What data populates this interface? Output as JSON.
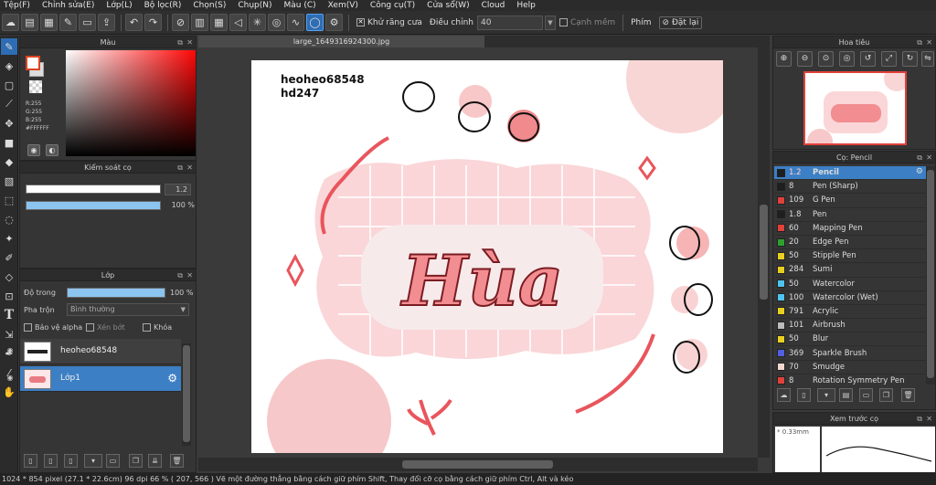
{
  "menu": [
    "Tệp(F)",
    "Chỉnh sửa(E)",
    "Lớp(L)",
    "Bộ lọc(R)",
    "Chọn(S)",
    "Chụp(N)",
    "Màu (C)",
    "Xem(V)",
    "Công cụ(T)",
    "Cửa sổ(W)",
    "Cloud",
    "Help"
  ],
  "toolbar": {
    "antialias_label": "Khử răng cưa",
    "adjust_label": "Điều chỉnh",
    "adjust_value": "40",
    "smooth_label": "Cạnh mềm",
    "key_label": "Phím",
    "reset_label": "Đặt lại"
  },
  "color_panel": {
    "title": "Màu",
    "r": "R:255",
    "g": "G:255",
    "b": "B:255",
    "hex": "#FFFFFF"
  },
  "brush_control": {
    "title": "Kiểm soát cọ",
    "size_value": "1.2",
    "opacity_value": "100 %",
    "opacity_fraction": 1.0
  },
  "layer_panel": {
    "title": "Lớp",
    "opacity_label": "Độ trong",
    "opacity_value": "100 %",
    "blend_label": "Pha trộn",
    "blend_value": "Bình thường",
    "protect_alpha": "Bảo vệ alpha",
    "clip": "Xén bớt",
    "lock": "Khóa",
    "layers": [
      {
        "name": "heoheo68548",
        "selected": false
      },
      {
        "name": "Lớp1",
        "selected": true
      }
    ]
  },
  "canvas": {
    "tab_title": "large_1649316924300.jpg",
    "text_line1": "heoheo68548",
    "text_line2": "hd247",
    "art_word": "Hùa"
  },
  "navigator": {
    "title": "Hoa tiêu"
  },
  "brush_panel": {
    "title": "Cọ: Pencil",
    "brushes": [
      {
        "size": "1.2",
        "name": "Pencil",
        "color": "#1e1e1e",
        "selected": true
      },
      {
        "size": "8",
        "name": "Pen (Sharp)",
        "color": "#1e1e1e",
        "selected": false
      },
      {
        "size": "109",
        "name": "G Pen",
        "color": "#e0413b",
        "selected": false
      },
      {
        "size": "1.8",
        "name": "Pen",
        "color": "#1e1e1e",
        "selected": false
      },
      {
        "size": "60",
        "name": "Mapping Pen",
        "color": "#e0413b",
        "selected": false
      },
      {
        "size": "20",
        "name": "Edge Pen",
        "color": "#2ea02e",
        "selected": false
      },
      {
        "size": "50",
        "name": "Stipple Pen",
        "color": "#e8d020",
        "selected": false
      },
      {
        "size": "284",
        "name": "Sumi",
        "color": "#e8d020",
        "selected": false
      },
      {
        "size": "50",
        "name": "Watercolor",
        "color": "#4fc4f0",
        "selected": false
      },
      {
        "size": "100",
        "name": "Watercolor (Wet)",
        "color": "#4fc4f0",
        "selected": false
      },
      {
        "size": "791",
        "name": "Acrylic",
        "color": "#e8d020",
        "selected": false
      },
      {
        "size": "101",
        "name": "Airbrush",
        "color": "#bbbbbb",
        "selected": false
      },
      {
        "size": "50",
        "name": "Blur",
        "color": "#e8d020",
        "selected": false
      },
      {
        "size": "369",
        "name": "Sparkle Brush",
        "color": "#5060e0",
        "selected": false
      },
      {
        "size": "70",
        "name": "Smudge",
        "color": "#f0d8d0",
        "selected": false
      },
      {
        "size": "8",
        "name": "Rotation Symmetry Pen",
        "color": "#e0413b",
        "selected": false
      }
    ]
  },
  "preview_panel": {
    "title": "Xem trước cọ",
    "size_text": "* 0.33mm"
  },
  "status": {
    "text": "1024 * 854 pixel   (27.1 * 22.6cm)   96 dpi   66 %   ( 207, 566 )   Vẽ một đường thẳng bằng cách giữ phím Shift, Thay đổi cỡ cọ bằng cách giữ phím Ctrl, Alt và kéo"
  },
  "colors": {
    "accent": "#3c7fc4",
    "art_pink": "#f5b4b8",
    "art_red": "#e0413b"
  }
}
